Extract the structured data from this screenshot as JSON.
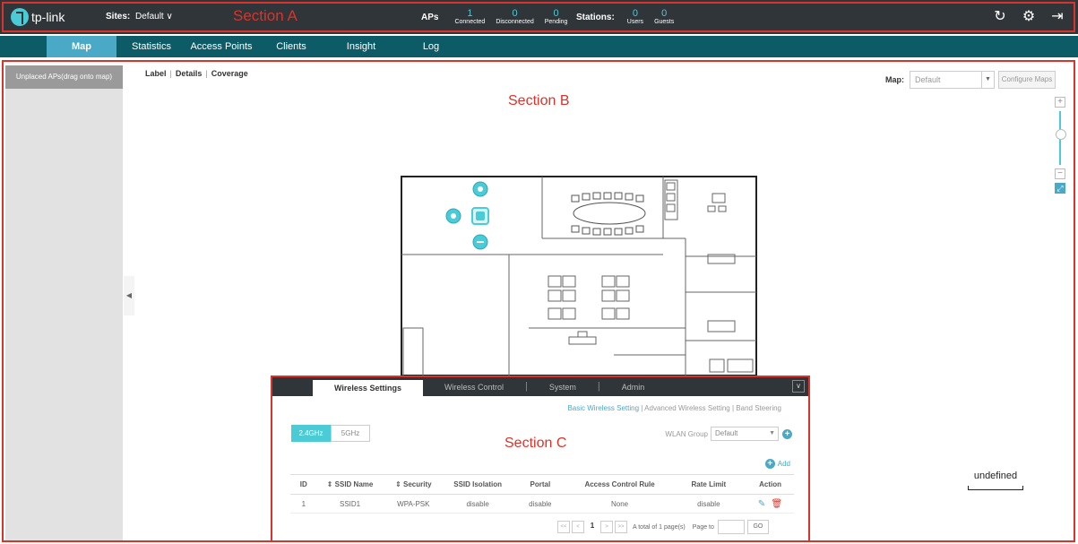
{
  "header": {
    "brand": "tp-link",
    "sites_label": "Sites:",
    "sites_value": "Default",
    "section_label": "Section A",
    "aps_label": "APs",
    "aps": [
      {
        "value": "1",
        "caption": "Connected"
      },
      {
        "value": "0",
        "caption": "Disconnected"
      },
      {
        "value": "0",
        "caption": "Pending"
      }
    ],
    "stations_label": "Stations:",
    "stations": [
      {
        "value": "0",
        "caption": "Users"
      },
      {
        "value": "0",
        "caption": "Guests"
      }
    ],
    "icons": [
      "refresh-icon",
      "gear-icon",
      "logout-icon"
    ]
  },
  "nav": {
    "tabs": [
      "Map",
      "Statistics",
      "Access Points",
      "Clients",
      "Insight",
      "Log"
    ],
    "active": "Map"
  },
  "map": {
    "unplaced_label": "Unplaced APs(drag onto map)",
    "view_options": [
      "Label",
      "Details",
      "Coverage"
    ],
    "section_label": "Section B",
    "map_label": "Map:",
    "map_value": "Default",
    "configure_label": "Configure Maps",
    "scale_text": "undefined"
  },
  "panel": {
    "tabs": [
      "Wireless Settings",
      "Wireless Control",
      "System",
      "Admin"
    ],
    "active_tab": "Wireless Settings",
    "sublinks": [
      "Basic Wireless Setting",
      "Advanced Wireless Setting",
      "Band Steering"
    ],
    "bands": [
      "2.4GHz",
      "5GHz"
    ],
    "section_label": "Section C",
    "wlan_label": "WLAN Group",
    "wlan_value": "Default",
    "add_label": "Add",
    "columns": [
      "ID",
      "⇕ SSID Name",
      "⇕ Security",
      "SSID Isolation",
      "Portal",
      "Access Control Rule",
      "Rate Limit",
      "Action"
    ],
    "rows": [
      [
        "1",
        "SSID1",
        "WPA-PSK",
        "disable",
        "disable",
        "None",
        "disable"
      ]
    ],
    "pager": {
      "page": "1",
      "info": "A total of 1 page(s)",
      "page_to": "Page to",
      "go": "GO"
    }
  }
}
